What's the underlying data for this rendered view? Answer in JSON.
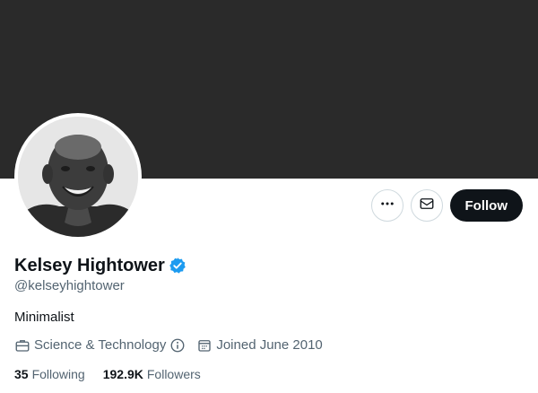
{
  "profile": {
    "display_name": "Kelsey Hightower",
    "handle": "@kelseyhightower",
    "bio": "Minimalist",
    "verified": true,
    "category": "Science & Technology",
    "joined": "Joined June 2010",
    "following_count": "35",
    "following_label": "Following",
    "followers_count": "192.9K",
    "followers_label": "Followers"
  },
  "actions": {
    "more_icon": "more-horizontal-icon",
    "message_icon": "envelope-icon",
    "follow_label": "Follow"
  },
  "icons": {
    "verified": "verified-badge-icon",
    "category": "briefcase-icon",
    "info": "info-circle-icon",
    "calendar": "calendar-icon"
  },
  "colors": {
    "banner": "#2a2a2a",
    "verified_blue": "#1d9bf0",
    "follow_button": "#0f1419",
    "secondary_text": "#536471",
    "border": "#cfd9de"
  }
}
